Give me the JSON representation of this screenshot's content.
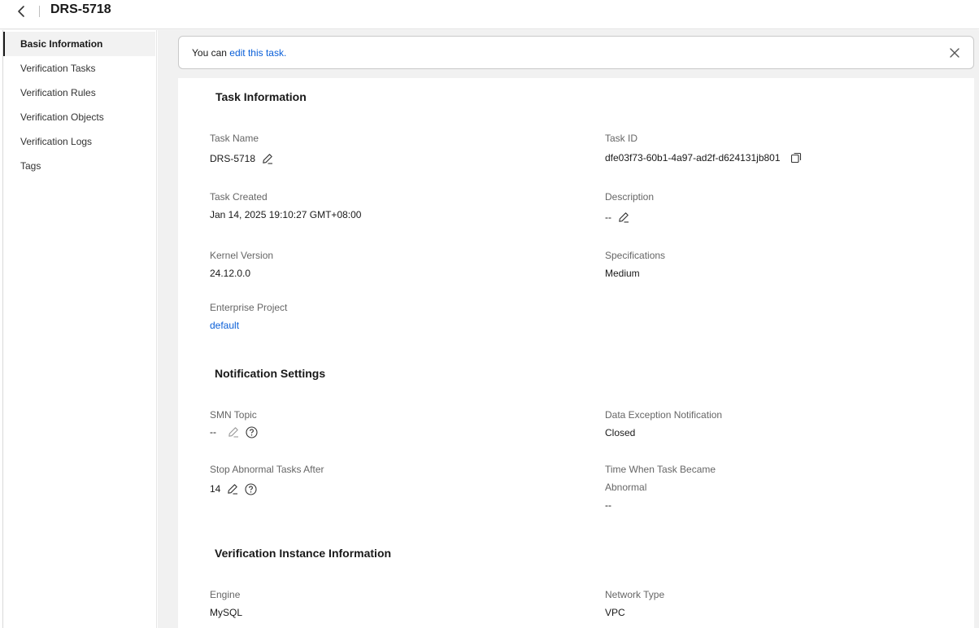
{
  "header": {
    "title": "DRS-5718"
  },
  "sidebar": {
    "items": [
      {
        "label": "Basic Information"
      },
      {
        "label": "Verification Tasks"
      },
      {
        "label": "Verification Rules"
      },
      {
        "label": "Verification Objects"
      },
      {
        "label": "Verification Logs"
      },
      {
        "label": "Tags"
      }
    ]
  },
  "notice": {
    "prefix": "You can ",
    "link": "edit this task."
  },
  "task_info": {
    "title": "Task Information",
    "task_name_label": "Task Name",
    "task_name": "DRS-5718",
    "task_id_label": "Task ID",
    "task_id": "dfe03f73-60b1-4a97-ad2f-d624131jb801",
    "created_label": "Task Created",
    "created": "Jan 14, 2025 19:10:27 GMT+08:00",
    "description_label": "Description",
    "description": "--",
    "kernel_label": "Kernel Version",
    "kernel": "24.12.0.0",
    "spec_label": "Specifications",
    "spec": "Medium",
    "project_label": "Enterprise Project",
    "project": "default"
  },
  "notification": {
    "title": "Notification Settings",
    "smn_label": "SMN Topic",
    "smn": "--",
    "exception_label": "Data Exception Notification",
    "exception": "Closed",
    "stop_label": "Stop Abnormal Tasks After",
    "stop": "14",
    "abnormal_label_1": "Time When Task Became",
    "abnormal_label_2": "Abnormal",
    "abnormal": "--"
  },
  "instance": {
    "title": "Verification Instance Information",
    "engine_label": "Engine",
    "engine": "MySQL",
    "network_label": "Network Type",
    "network": "VPC"
  },
  "colors": {
    "link": "#0a5fd8",
    "main_bg": "#f1f1f1",
    "active_nav_bg": "#f2f2f2"
  }
}
